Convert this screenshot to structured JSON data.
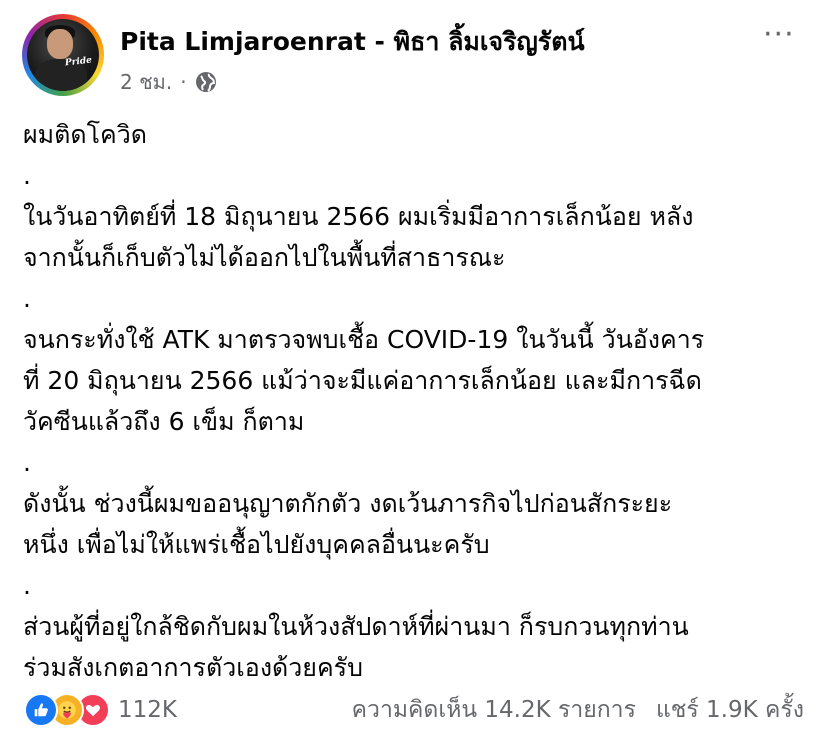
{
  "post": {
    "author": "Pita Limjaroenrat - พิธา ลิ้มเจริญรัตน์",
    "time": "2 ชม.",
    "meta_dot": "·",
    "avatar_text": "Pride",
    "more_label": "···",
    "lines": [
      "ผมติดโควิด",
      ".",
      "ในวันอาทิตย์ที่ 18 มิถุนายน 2566 ผมเริ่มมีอาการเล็กน้อย หลัง",
      "จากนั้นก็เก็บตัวไม่ได้ออกไปในพื้นที่สาธารณะ",
      ".",
      "จนกระทั่งใช้ ATK มาตรวจพบเชื้อ COVID-19 ในวันนี้ วันอังคาร",
      "ที่ 20 มิถุนายน 2566 แม้ว่าจะมีแค่อาการเล็กน้อย และมีการฉีด",
      "วัคซีนแล้วถึง 6 เข็ม ก็ตาม",
      ".",
      "ดังนั้น ช่วงนี้ผมขออนุญาตกักตัว งดเว้นภารกิจไปก่อนสักระยะ",
      "หนึ่ง เพื่อไม่ให้แพร่เชื้อไปยังบุคคลอื่นนะครับ",
      ".",
      "ส่วนผู้ที่อยู่ใกล้ชิดกับผมในห้วงสัปดาห์ที่ผ่านมา ก็รบกวนทุกท่าน",
      "ร่วมสังเกตอาการตัวเองด้วยครับ"
    ]
  },
  "footer": {
    "reactions_count": "112K",
    "comments": "ความคิดเห็น 14.2K รายการ",
    "shares": "แชร์ 1.9K ครั้ง",
    "reaction_icons": [
      "like-icon",
      "care-icon",
      "love-icon"
    ]
  },
  "colors": {
    "text": "#050505",
    "secondary": "#65676b",
    "like": "#1877f2",
    "care": "#f7b125",
    "love": "#f33e58"
  }
}
